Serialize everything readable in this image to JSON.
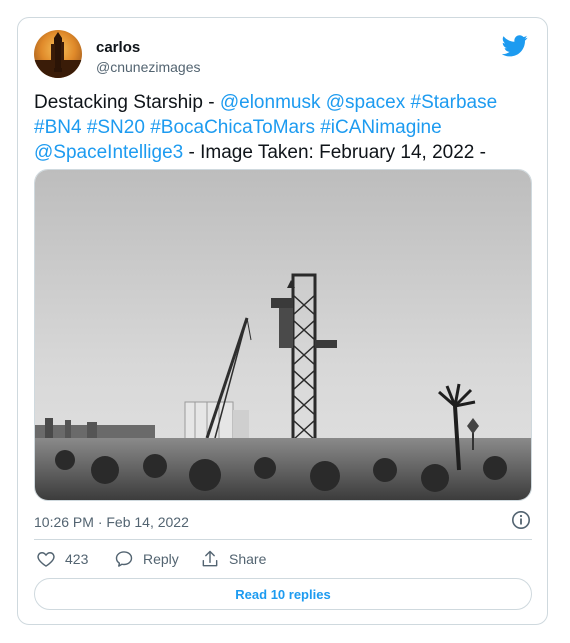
{
  "user": {
    "name": "carlos",
    "handle": "@cnunezimages"
  },
  "tweet": {
    "segments": [
      {
        "text": "Destacking Starship - ",
        "link": false
      },
      {
        "text": "@elonmusk",
        "link": true
      },
      {
        "text": " ",
        "link": false
      },
      {
        "text": "@spacex",
        "link": true
      },
      {
        "text": " ",
        "link": false
      },
      {
        "text": "#Starbase",
        "link": true
      },
      {
        "text": " ",
        "link": false
      },
      {
        "text": "#BN4",
        "link": true
      },
      {
        "text": " ",
        "link": false
      },
      {
        "text": "#SN20",
        "link": true
      },
      {
        "text": " ",
        "link": false
      },
      {
        "text": "#BocaChicaToMars",
        "link": true
      },
      {
        "text": " ",
        "link": false
      },
      {
        "text": "#iCANimagine",
        "link": true
      },
      {
        "text": " ",
        "link": false
      },
      {
        "text": "@SpaceIntellige3",
        "link": true
      },
      {
        "text": "  - Image Taken: February 14, 2022 -",
        "link": false
      }
    ],
    "timestamp": "10:26 PM · Feb 14, 2022"
  },
  "actions": {
    "like_icon": "heart-icon",
    "like_count": "423",
    "reply_icon": "speech-bubble-icon",
    "reply_label": "Reply",
    "share_icon": "share-upload-icon",
    "share_label": "Share"
  },
  "footer": {
    "read_replies_label": "Read 10 replies"
  },
  "colors": {
    "link": "#1d9bf0",
    "twitter_brand": "#1d9bf0",
    "secondary_text": "#536471",
    "border": "#cfd9de"
  },
  "icons": {
    "brand": "twitter-bird-icon",
    "info": "info-icon"
  }
}
